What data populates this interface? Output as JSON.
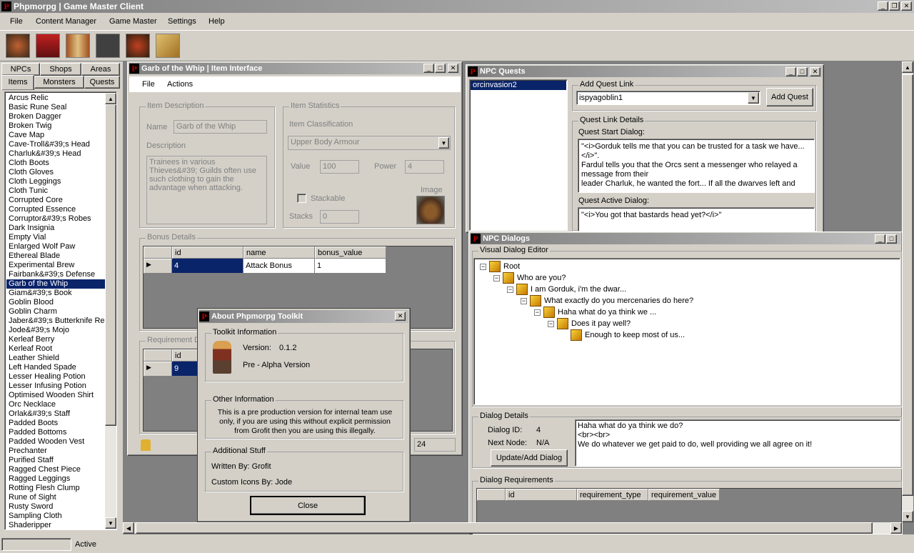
{
  "app": {
    "title": "Phpmorpg | Game Master Client"
  },
  "menubar": {
    "items": [
      "File",
      "Content Manager",
      "Game Master",
      "Settings",
      "Help"
    ]
  },
  "toolbar": {
    "icons": [
      "npc-editor-icon",
      "item-editor-icon",
      "book-icon",
      "players-icon",
      "armour-icon",
      "map-icon"
    ]
  },
  "left_panel": {
    "tabs_row1": [
      "NPCs",
      "Shops",
      "Areas"
    ],
    "tabs_row2": [
      "Items",
      "Monsters",
      "Quests"
    ],
    "items": [
      "Arcus Relic",
      "Basic Rune Seal",
      "Broken Dagger",
      "Broken Twig",
      "Cave Map",
      "Cave-Troll&#39;s Head",
      "Charluk&#39;s Head",
      "Cloth Boots",
      "Cloth Gloves",
      "Cloth Leggings",
      "Cloth Tunic",
      "Corrupted Core",
      "Corrupted Essence",
      "Corruptor&#39;s Robes",
      "Dark Insignia",
      "Empty Vial",
      "Enlarged Wolf Paw",
      "Ethereal Blade",
      "Experimental Brew",
      "Fairbank&#39;s Defense",
      "Garb of the Whip",
      "Giam&#39;s Book",
      "Goblin Blood",
      "Goblin Charm",
      "Jaber&#39;s Butterknife Rep",
      "Jode&#39;s Mojo",
      "Kerleaf Berry",
      "Kerleaf Root",
      "Leather Shield",
      "Left Handed Spade",
      "Lesser Healing Potion",
      "Lesser Infusing Potion",
      "Optimised Wooden Shirt",
      "Orc Necklace",
      "Orlak&#39;s Staff",
      "Padded Boots",
      "Padded Bottoms",
      "Padded Wooden Vest",
      "Prechanter",
      "Purified Staff",
      "Ragged Chest Piece",
      "Ragged Leggings",
      "Rotting Flesh Clump",
      "Rune of Sight",
      "Rusty Sword",
      "Sampling Cloth",
      "Shaderipper"
    ],
    "selected": "Garb of the Whip"
  },
  "item_window": {
    "title": "Garb of the Whip | Item Interface",
    "menu": [
      "File",
      "Actions"
    ],
    "description_group": "Item Description",
    "name_label": "Name",
    "name_value": "Garb of the Whip",
    "description_label": "Description",
    "description_value": "Trainees in various Thieves&#39; Guilds often use such clothing to gain the advantage when attacking.",
    "stats_group": "Item Statistics",
    "classification_label": "Item Classification",
    "classification_value": "Upper Body Armour",
    "value_label": "Value",
    "value_value": "100",
    "power_label": "Power",
    "power_value": "4",
    "stackable_label": "Stackable",
    "image_label": "Image",
    "stacks_label": "Stacks",
    "stacks_value": "0",
    "bonus_group": "Bonus Details",
    "bonus_columns": [
      "id",
      "name",
      "bonus_value"
    ],
    "bonus_row": [
      "4",
      "Attack Bonus",
      "1"
    ],
    "requirement_group": "Requirement D",
    "requirement_col": "id",
    "requirement_row": "9",
    "bottom_value": "24"
  },
  "about": {
    "title": "About Phpmorpg Toolkit",
    "toolkit_group": "Toolkit Information",
    "version_label": "Version:",
    "version_value": "0.1.2",
    "stage": "Pre - Alpha Version",
    "other_group": "Other Information",
    "other_text": "This is a pre production version for internal team use only, if you are using this without explicit permission from Grofit then you are using this illegally.",
    "additional_group": "Additional Stuff",
    "written_by": "Written By: Grofit",
    "icons_by": "Custom Icons By: Jode",
    "close_label": "Close"
  },
  "quests_window": {
    "title": "NPC Quests",
    "list": [
      "orcinvasion2"
    ],
    "add_group": "Add Quest Link",
    "select_value": "ispyagoblin1",
    "add_button": "Add Quest",
    "details_group": "Quest Link Details",
    "start_label": "Quest Start Dialog:",
    "start_text": "\"<i>Gorduk tells me that you can be trusted for a task we have...</i>\".\nFardul tells you that the Orcs sent a messenger who relayed a message from their\nleader Charluk, he wanted the fort... If all the dwarves left and",
    "active_label": "Quest Active Dialog:",
    "active_text": "\"<i>You got that bastards head yet?</i>\""
  },
  "dialogs_window": {
    "title": "NPC Dialogs",
    "editor_group": "Visual Dialog Editor",
    "tree": [
      "Root",
      "Who are you?",
      "I am Gorduk, i'm the dwar...",
      "What exactly do you mercenaries do here?",
      "Haha what do ya think we ...",
      "Does it pay well?",
      "Enough to keep most of us..."
    ],
    "details_group": "Dialog Details",
    "dialog_id_label": "Dialog ID:",
    "dialog_id_value": "4",
    "next_node_label": "Next Node:",
    "next_node_value": "N/A",
    "update_button": "Update/Add Dialog",
    "dialog_text": "Haha what do ya think we do?\n<br><br>\nWe do whatever we get paid to do, well providing we all agree on it!",
    "req_group": "Dialog Requirements",
    "req_columns": [
      "id",
      "requirement_type",
      "requirement_value"
    ]
  },
  "statusbar": {
    "status": "Active"
  },
  "colors": {
    "title_gradient": "#a8a8a8",
    "selection": "#0a246a",
    "mdi_bg": "#808080"
  }
}
